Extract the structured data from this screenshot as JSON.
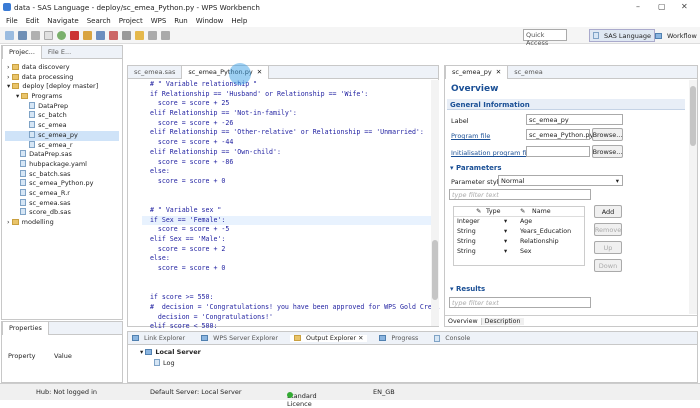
{
  "window": {
    "title": "data - SAS Language - deploy/sc_emea_Python.py - WPS Workbench"
  },
  "menu": [
    "File",
    "Edit",
    "Navigate",
    "Search",
    "Project",
    "WPS",
    "Run",
    "Window",
    "Help"
  ],
  "toolbar": {
    "quick_access": "Quick Access",
    "perspectives": [
      "SAS Language",
      "Workflow"
    ]
  },
  "project_explorer": {
    "tabs": [
      "Projec...",
      "File E..."
    ],
    "items": [
      {
        "label": "data discovery",
        "depth": 0,
        "type": "project"
      },
      {
        "label": "data processing",
        "depth": 0,
        "type": "project"
      },
      {
        "label": "deploy [deploy master]",
        "depth": 0,
        "type": "project"
      },
      {
        "label": "Programs",
        "depth": 1,
        "type": "folder"
      },
      {
        "label": "DataPrep",
        "depth": 2,
        "type": "file"
      },
      {
        "label": "sc_batch",
        "depth": 2,
        "type": "file"
      },
      {
        "label": "sc_emea",
        "depth": 2,
        "type": "file"
      },
      {
        "label": "sc_emea_py",
        "depth": 2,
        "type": "file",
        "selected": true
      },
      {
        "label": "sc_emea_r",
        "depth": 2,
        "type": "file"
      },
      {
        "label": "DataPrep.sas",
        "depth": 1,
        "type": "file"
      },
      {
        "label": "hubpackage.yaml",
        "depth": 1,
        "type": "file"
      },
      {
        "label": "sc_batch.sas",
        "depth": 1,
        "type": "file"
      },
      {
        "label": "sc_emea_Python.py",
        "depth": 1,
        "type": "file"
      },
      {
        "label": "sc_emea_R.r",
        "depth": 1,
        "type": "file"
      },
      {
        "label": "sc_emea.sas",
        "depth": 1,
        "type": "file"
      },
      {
        "label": "score_db.sas",
        "depth": 1,
        "type": "file"
      },
      {
        "label": "modelling",
        "depth": 0,
        "type": "project"
      }
    ]
  },
  "properties": {
    "tab": "Properties",
    "col_property": "Property",
    "col_value": "Value"
  },
  "editor": {
    "tabs": [
      "sc_emea.sas",
      "sc_emea_Python.py"
    ],
    "lines": [
      "  # \" Variable relationship \"",
      "  if Relationship == 'Husband' or Relationship == 'Wife':",
      "    score = score + 25",
      "  elif Relationship == 'Not-in-family':",
      "    score = score + -26",
      "  elif Relationship == 'Other-relative' or Relationship == 'Unmarried':",
      "    score = score + -44",
      "  elif Relationship == 'Own-child':",
      "    score = score + -86",
      "  else:",
      "    score = score + 0",
      "",
      "",
      "  # \" Variable sex \"",
      "  if Sex == 'Female':",
      "    score = score + -5",
      "  elif Sex == 'Male':",
      "    score = score + 2",
      "  else:",
      "    score = score + 0",
      "",
      "",
      "  if score >= 550:",
      "  #  decision = 'Congratulations! you have been approved for WPS Gold Credi",
      "    decision = 'Congratulations!'",
      "  elif score < 500:",
      "    decision = 'Please call us: 0800 WPS BANK'"
    ]
  },
  "overview": {
    "tabs": [
      "sc_emea_py",
      "sc_emea"
    ],
    "heading": "Overview",
    "general_info": "General Information",
    "label_lbl": "Label",
    "label_val": "sc_emea_py",
    "program_file_lbl": "Program file",
    "program_file_val": "sc_emea_Python.py",
    "init_file_lbl": "Initialisation program file",
    "init_file_val": "",
    "browse": "Browse...",
    "parameters": "Parameters",
    "param_style_lbl": "Parameter style:",
    "param_style_val": "Normal",
    "filter_placeholder": "type filter text",
    "col_type": "Type",
    "col_name": "Name",
    "params": [
      {
        "type": "Integer",
        "name": "Age"
      },
      {
        "type": "String",
        "name": "Years_Education"
      },
      {
        "type": "String",
        "name": "Relationship"
      },
      {
        "type": "String",
        "name": "Sex"
      }
    ],
    "btn_add": "Add",
    "btn_remove": "Remove",
    "btn_up": "Up",
    "btn_down": "Down",
    "results": "Results",
    "bottom_tabs": [
      "Overview",
      "Description"
    ]
  },
  "bottom_panel": {
    "tabs": [
      "Link Explorer",
      "WPS Server Explorer",
      "Output Explorer",
      "Progress",
      "Console"
    ],
    "tree": [
      "Local Server",
      "Log"
    ]
  },
  "status": {
    "hub": "Hub: Not logged in",
    "server": "Default Server: Local Server",
    "licence": "Standard Licence",
    "locale": "EN_GB"
  }
}
